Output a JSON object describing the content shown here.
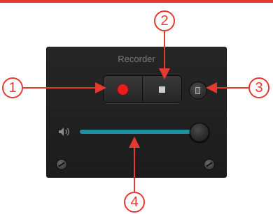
{
  "panel": {
    "title": "Recorder"
  },
  "controls": {
    "record_icon": "record-dot-icon",
    "stop_icon": "stop-square-icon",
    "extra_icon": "clipboard-icon",
    "volume_icon": "speaker-icon"
  },
  "volume": {
    "level": 0.98
  },
  "callouts": [
    "1",
    "2",
    "3",
    "4"
  ],
  "colors": {
    "accent": "#e43a30",
    "record": "#ee1b1b",
    "slider": "#1f8fa4",
    "panel_bg": "#1c1c1c"
  }
}
